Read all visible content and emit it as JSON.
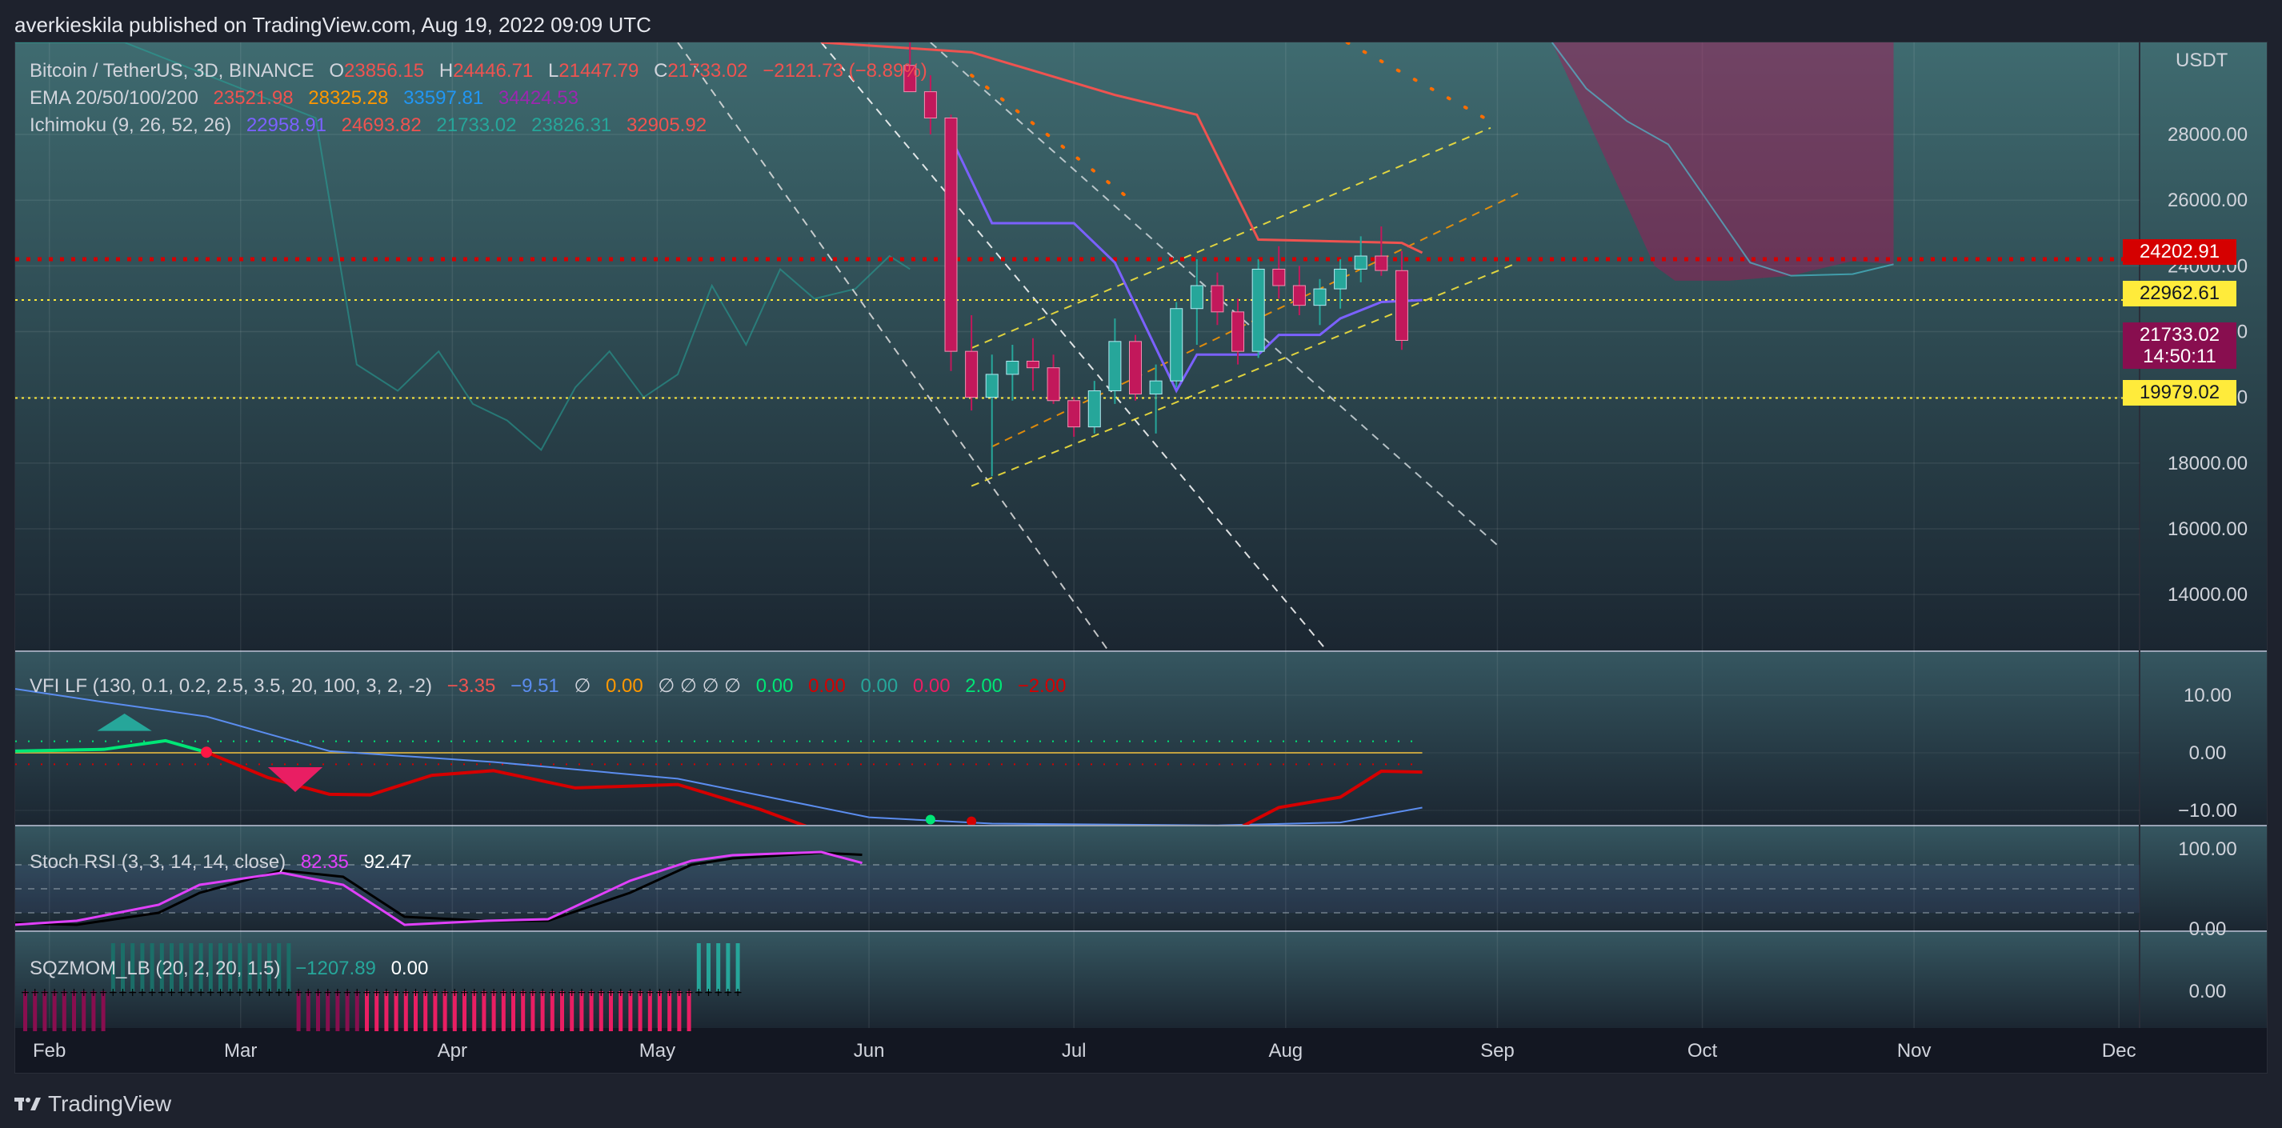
{
  "header": {
    "text": "averkieskila published on TradingView.com, Aug 19, 2022 09:09 UTC"
  },
  "footer": {
    "brand": "TradingView"
  },
  "colors": {
    "bg": "#131722",
    "bull": "#26a69a",
    "bear": "#c2185b",
    "kijun": "#ef5350",
    "tenkan": "#7b61ff",
    "price_line": "#d50000",
    "level": "#ffeb3b",
    "cloud_bear": "#ad1457",
    "cloud_teal": "#4dd0e1"
  },
  "legend": {
    "main": {
      "symbol": "Bitcoin / TetherUS, 3D, BINANCE",
      "o_label": "O",
      "o": "23856.15",
      "h_label": "H",
      "h": "24446.71",
      "l_label": "L",
      "l": "21447.79",
      "c_label": "C",
      "c": "21733.02",
      "chg": "−2121.73 (−8.89%)"
    },
    "ema": {
      "label": "EMA 20/50/100/200",
      "v1": "23521.98",
      "v2": "28325.28",
      "v3": "33597.81",
      "v4": "34424.53"
    },
    "ichimoku": {
      "label": "Ichimoku (9, 26, 52, 26)",
      "v1": "22958.91",
      "v2": "24693.82",
      "v3": "21733.02",
      "v4": "23826.31",
      "v5": "32905.92"
    },
    "vfi": {
      "label": "VFI LF (130, 0.1, 0.2, 2.5, 3.5, 20, 100, 3, 2, -2)",
      "v1": "−3.35",
      "v2": "−9.51",
      "sym": "∅",
      "v3": "0.00",
      "syms": "∅ ∅ ∅ ∅",
      "v4": "0.00",
      "v5": "0.00",
      "v6": "0.00",
      "v7": "0.00",
      "v8": "2.00",
      "v9": "−2.00"
    },
    "stoch": {
      "label": "Stoch RSI (3, 3, 14, 14, close)",
      "v1": "82.35",
      "v2": "92.47"
    },
    "sqz": {
      "label": "SQZMOM_LB (20, 2, 20, 1.5)",
      "v1": "−1207.89",
      "v2": "0.00"
    }
  },
  "axis": {
    "unit": "USDT"
  },
  "price_tags": [
    {
      "value": "24202.91",
      "bg": "#d50000",
      "fg": "#ffffff"
    },
    {
      "value": "22962.61",
      "bg": "#ffeb3b",
      "fg": "#131722"
    },
    {
      "value": "21733.02",
      "sub": "14:50:11",
      "bg": "#880e4f",
      "fg": "#ffffff"
    },
    {
      "value": "19979.02",
      "bg": "#ffeb3b",
      "fg": "#131722"
    }
  ],
  "chart_data": {
    "type": "candlestick",
    "title": "Bitcoin / TetherUS, 3D, BINANCE",
    "x_labels": [
      "Feb",
      "Mar",
      "Apr",
      "May",
      "Jun",
      "Jul",
      "Aug",
      "Sep",
      "Oct",
      "Nov",
      "Dec"
    ],
    "y_ticks": [
      14000,
      16000,
      18000,
      20000,
      22000,
      24000,
      26000,
      28000
    ],
    "y_tick_labels": [
      "14000.00",
      "16000.00",
      "18000.00",
      "20000.00",
      "22000.00",
      "24000.00",
      "26000.00",
      "28000.00"
    ],
    "ylim": [
      12300,
      30800
    ],
    "horizontal_levels": [
      {
        "price": 24202.91,
        "style": "dotted",
        "color": "#d50000"
      },
      {
        "price": 22962.61,
        "style": "dotted",
        "color": "#ffeb3b"
      },
      {
        "price": 19979.02,
        "style": "dotted",
        "color": "#ffeb3b"
      }
    ],
    "candles": [
      [
        "2022-06-07",
        30100,
        31500,
        29300,
        29300
      ],
      [
        "2022-06-10",
        29300,
        29800,
        28000,
        28500
      ],
      [
        "2022-06-13",
        28500,
        28600,
        20800,
        21400
      ],
      [
        "2022-06-16",
        21400,
        22500,
        19600,
        20000
      ],
      [
        "2022-06-19",
        20000,
        21300,
        17600,
        20700
      ],
      [
        "2022-06-22",
        20700,
        21600,
        19900,
        21100
      ],
      [
        "2022-06-25",
        21100,
        21800,
        20200,
        20900
      ],
      [
        "2022-06-28",
        20900,
        21300,
        19800,
        19900
      ],
      [
        "2022-07-01",
        19900,
        20000,
        18800,
        19100
      ],
      [
        "2022-07-04",
        19100,
        20500,
        18900,
        20200
      ],
      [
        "2022-07-07",
        20200,
        22400,
        19800,
        21700
      ],
      [
        "2022-07-10",
        21700,
        21900,
        19900,
        20100
      ],
      [
        "2022-07-13",
        20100,
        21000,
        18900,
        20500
      ],
      [
        "2022-07-16",
        20500,
        22900,
        20300,
        22700
      ],
      [
        "2022-07-19",
        22700,
        24200,
        21600,
        23400
      ],
      [
        "2022-07-22",
        23400,
        23800,
        22200,
        22600
      ],
      [
        "2022-07-25",
        22600,
        23000,
        21000,
        21400
      ],
      [
        "2022-07-28",
        21400,
        24200,
        21200,
        23900
      ],
      [
        "2022-07-31",
        23900,
        24600,
        23000,
        23400
      ],
      [
        "2022-08-03",
        23400,
        24000,
        22500,
        22800
      ],
      [
        "2022-08-06",
        22800,
        23600,
        22200,
        23300
      ],
      [
        "2022-08-09",
        23300,
        24200,
        22700,
        23900
      ],
      [
        "2022-08-12",
        23900,
        24900,
        23500,
        24300
      ],
      [
        "2022-08-15",
        24300,
        25200,
        23700,
        23860
      ],
      [
        "2022-08-18",
        23856,
        24447,
        21448,
        21733
      ]
    ],
    "series": [
      {
        "name": "Kijun",
        "points": [
          [
            "2022-05-25",
            30800
          ],
          [
            "2022-06-16",
            30500
          ],
          [
            "2022-07-07",
            29200
          ],
          [
            "2022-07-19",
            28600
          ],
          [
            "2022-07-28",
            24800
          ],
          [
            "2022-08-18",
            24700
          ],
          [
            "2022-08-21",
            24400
          ]
        ]
      },
      {
        "name": "Tenkan",
        "points": [
          [
            "2022-06-13",
            27900
          ],
          [
            "2022-06-19",
            25300
          ],
          [
            "2022-07-01",
            25300
          ],
          [
            "2022-07-07",
            24100
          ],
          [
            "2022-07-13",
            21500
          ],
          [
            "2022-07-16",
            20200
          ],
          [
            "2022-07-19",
            21300
          ],
          [
            "2022-07-28",
            21300
          ],
          [
            "2022-07-31",
            21900
          ],
          [
            "2022-08-06",
            21900
          ],
          [
            "2022-08-09",
            22400
          ],
          [
            "2022-08-15",
            22900
          ],
          [
            "2022-08-21",
            22960
          ]
        ]
      }
    ]
  },
  "vfi": {
    "ticks": [
      "10.00",
      "0.00",
      "−10.00"
    ],
    "ylim": [
      -12.5,
      17.5
    ],
    "vfi_line": [
      [
        "2022-01-27",
        0.3
      ],
      [
        "2022-02-09",
        0.6
      ],
      [
        "2022-02-18",
        2.1
      ],
      [
        "2022-02-24",
        0.1
      ],
      [
        "2022-03-05",
        -4.3
      ],
      [
        "2022-03-14",
        -7.2
      ],
      [
        "2022-03-20",
        -7.3
      ],
      [
        "2022-03-29",
        -3.9
      ],
      [
        "2022-04-07",
        -3.1
      ],
      [
        "2022-04-19",
        -6.1
      ],
      [
        "2022-05-04",
        -5.5
      ],
      [
        "2022-05-16",
        -9.8
      ],
      [
        "2022-05-28",
        -15.0
      ],
      [
        "2022-07-22",
        -15.0
      ],
      [
        "2022-07-31",
        -9.5
      ],
      [
        "2022-08-09",
        -7.7
      ],
      [
        "2022-08-15",
        -3.2
      ],
      [
        "2022-08-21",
        -3.35
      ]
    ],
    "signal_line": [
      [
        "2022-01-27",
        11.1
      ],
      [
        "2022-02-09",
        8.8
      ],
      [
        "2022-02-24",
        6.3
      ],
      [
        "2022-03-14",
        0.3
      ],
      [
        "2022-04-07",
        -1.6
      ],
      [
        "2022-05-04",
        -4.5
      ],
      [
        "2022-06-01",
        -11.2
      ],
      [
        "2022-06-19",
        -12.3
      ],
      [
        "2022-07-22",
        -12.6
      ],
      [
        "2022-08-09",
        -12.1
      ],
      [
        "2022-08-21",
        -9.51
      ]
    ]
  },
  "stoch": {
    "ticks": [
      "100.00",
      "0.00"
    ],
    "k": [
      [
        "2022-01-27",
        20
      ],
      [
        "2022-02-09",
        90
      ],
      [
        "2022-02-21",
        70
      ],
      [
        "2022-03-02",
        55
      ],
      [
        "2022-03-11",
        70
      ],
      [
        "2022-03-20",
        60
      ],
      [
        "2022-03-29",
        90
      ],
      [
        "2022-04-07",
        85
      ],
      [
        "2022-04-19",
        45
      ],
      [
        "2022-05-01",
        20
      ],
      [
        "2022-05-19",
        3
      ],
      [
        "2022-06-01",
        10
      ],
      [
        "2022-06-13",
        30
      ],
      [
        "2022-06-19",
        55
      ],
      [
        "2022-07-01",
        70
      ],
      [
        "2022-07-10",
        55
      ],
      [
        "2022-07-19",
        5
      ],
      [
        "2022-07-31",
        10
      ],
      [
        "2022-08-09",
        12
      ],
      [
        "2022-08-21",
        60
      ],
      [
        "2022-08-30",
        85
      ],
      [
        "2022-09-05",
        92
      ],
      [
        "2022-09-18",
        96
      ],
      [
        "2022-09-24",
        82.35
      ]
    ],
    "d": [
      [
        "2022-01-27",
        10
      ],
      [
        "2022-02-09",
        80
      ],
      [
        "2022-02-21",
        78
      ],
      [
        "2022-03-02",
        60
      ],
      [
        "2022-03-11",
        65
      ],
      [
        "2022-03-20",
        65
      ],
      [
        "2022-03-29",
        85
      ],
      [
        "2022-04-07",
        85
      ],
      [
        "2022-04-19",
        55
      ],
      [
        "2022-05-01",
        25
      ],
      [
        "2022-05-19",
        8
      ],
      [
        "2022-06-01",
        5
      ],
      [
        "2022-06-13",
        20
      ],
      [
        "2022-06-19",
        45
      ],
      [
        "2022-07-01",
        73
      ],
      [
        "2022-07-10",
        65
      ],
      [
        "2022-07-19",
        15
      ],
      [
        "2022-07-31",
        10
      ],
      [
        "2022-08-09",
        10
      ],
      [
        "2022-08-21",
        45
      ],
      [
        "2022-08-30",
        80
      ],
      [
        "2022-09-05",
        88
      ],
      [
        "2022-09-18",
        95
      ],
      [
        "2022-09-24",
        92.47
      ]
    ]
  },
  "sqz": {
    "tick": "0.00",
    "bars": [
      -1,
      -1,
      -1,
      -1,
      -1,
      -1,
      -1,
      -1,
      -1,
      1,
      1,
      1,
      1,
      1,
      1,
      1,
      1,
      1,
      1,
      1,
      1,
      1,
      1,
      1,
      1,
      1,
      1,
      1,
      -1,
      -1,
      -1,
      -1,
      -1,
      -1,
      -1,
      -1,
      -1,
      -1,
      -1,
      -1,
      -1,
      -1,
      -1,
      -1,
      -1,
      -1,
      -1,
      -1,
      -1,
      -1,
      -1,
      -1,
      -1,
      -1,
      -1,
      -1,
      -1,
      -1,
      -1,
      -1,
      -1,
      -1,
      -1,
      -1,
      -1,
      -1,
      -1,
      -1,
      -1,
      1,
      1,
      1,
      1,
      1
    ]
  }
}
